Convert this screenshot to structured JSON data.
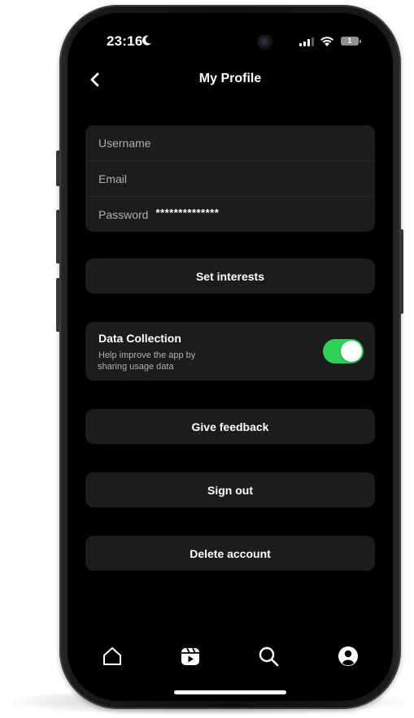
{
  "status_bar": {
    "time": "23:16",
    "battery_level": "1",
    "icons": [
      "moon-icon",
      "camera-icon",
      "cellular-signal-icon",
      "wifi-icon",
      "battery-icon"
    ]
  },
  "header": {
    "title": "My Profile",
    "back_icon": "chevron-left-icon"
  },
  "account_fields": {
    "username_label": "Username",
    "email_label": "Email",
    "password_label": "Password",
    "password_value": "**************"
  },
  "buttons": {
    "set_interests": "Set interests",
    "give_feedback": "Give feedback",
    "sign_out": "Sign out",
    "delete_account": "Delete account"
  },
  "data_collection": {
    "title": "Data Collection",
    "description_line1": "Help improve the app by",
    "description_line2": "sharing usage data",
    "enabled": true
  },
  "tab_bar": {
    "items": [
      "home-icon",
      "reels-icon",
      "search-icon",
      "profile-icon"
    ],
    "active": "profile-icon"
  },
  "colors": {
    "background": "#000000",
    "card": "#1c1c1e",
    "toggle_on": "#30d158",
    "text_primary": "#ffffff",
    "text_secondary": "#aeaeb2"
  }
}
